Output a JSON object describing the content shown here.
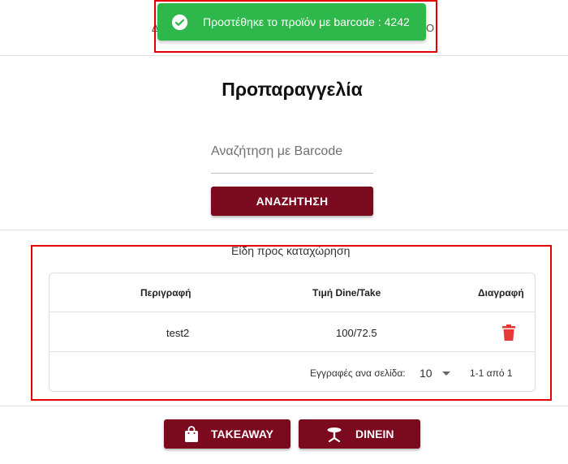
{
  "colors": {
    "primary": "#7b0a1f",
    "success": "#2eb84b",
    "danger": "#e53935",
    "highlight": "#e40000"
  },
  "header": {
    "left_peek": "Δ",
    "right_peek": "Ο"
  },
  "snackbar": {
    "icon": "check-circle-icon",
    "message": "Προστέθηκε το προϊόν με barcode : 4242"
  },
  "page": {
    "title": "Προπαραγγελία"
  },
  "search": {
    "placeholder": "Αναζήτηση με Barcode",
    "button_label": "ΑΝΑΖΗΤΗΣΗ"
  },
  "items_section": {
    "title": "Είδη προς καταχώρηση",
    "columns": {
      "description": "Περιγραφή",
      "price": "Τιμή Dine/Take",
      "delete": "Διαγραφή"
    },
    "rows": [
      {
        "description": "test2",
        "price": "100/72.5",
        "delete_icon": "trash-icon"
      }
    ],
    "pagination": {
      "rows_per_page_label": "Εγγραφές ανα σελίδα:",
      "rows_per_page_value": "10",
      "range": "1-1 από 1"
    }
  },
  "actions": {
    "takeaway": {
      "label": "TAKEAWAY",
      "icon": "shopping-bag-icon"
    },
    "dinein": {
      "label": "DINEIN",
      "icon": "table-icon"
    }
  }
}
